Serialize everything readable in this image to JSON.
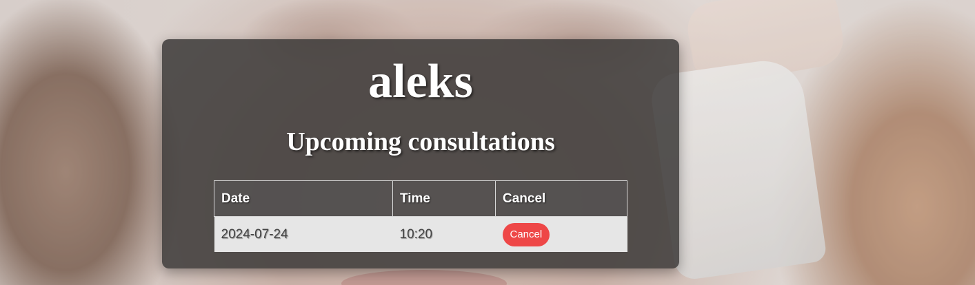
{
  "header": {
    "user_name": "aleks",
    "section_title": "Upcoming consultations"
  },
  "table": {
    "columns": [
      "Date",
      "Time",
      "Cancel"
    ],
    "rows": [
      {
        "date": "2024-07-24",
        "time": "10:20",
        "action_label": "Cancel"
      }
    ]
  },
  "colors": {
    "card_background": "#3c3a39",
    "cancel_button": "#ee4747",
    "row_background": "#e6e6e6"
  }
}
